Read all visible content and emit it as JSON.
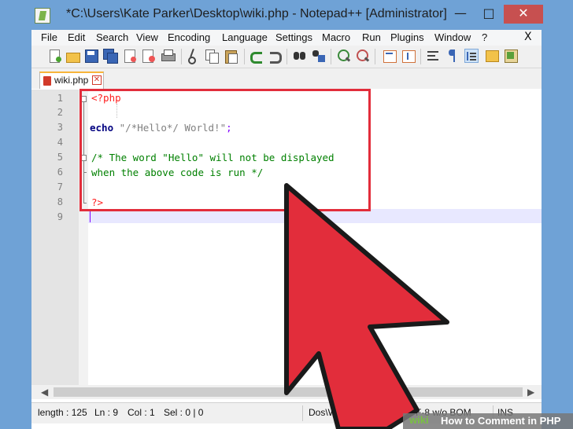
{
  "window": {
    "title": "*C:\\Users\\Kate Parker\\Desktop\\wiki.php - Notepad++ [Administrator]",
    "minimize_glyph": "—",
    "maximize_glyph": "□",
    "close_glyph": "✕"
  },
  "menu": {
    "items": [
      "File",
      "Edit",
      "Search",
      "View",
      "Encoding",
      "Language",
      "Settings",
      "Macro",
      "Run",
      "Plugins",
      "Window",
      "?"
    ],
    "close_glyph": "X"
  },
  "toolbar": {
    "icons": [
      "new-file-icon",
      "open-file-icon",
      "save-icon",
      "save-all-icon",
      "close-icon",
      "close-all-icon",
      "print-icon",
      "cut-icon",
      "copy-icon",
      "paste-icon",
      "undo-icon",
      "redo-icon",
      "find-icon",
      "replace-icon",
      "zoom-in-icon",
      "zoom-out-icon",
      "sync-vertical-icon",
      "sync-horizontal-icon",
      "word-wrap-icon",
      "show-all-chars-icon",
      "indent-guide-icon",
      "document-map-icon",
      "function-list-icon"
    ]
  },
  "tab": {
    "label": "wiki.php",
    "close_glyph": "✕"
  },
  "editor": {
    "line_numbers": [
      "1",
      "2",
      "3",
      "4",
      "5",
      "6",
      "7",
      "8",
      "9"
    ],
    "lines": {
      "l1": "<?php",
      "l3_kw": "echo",
      "l3_str": "\"/*Hello*/ World!\"",
      "l3_semicolon": ";",
      "l5": "/* The word \"Hello\" will not be displayed",
      "l6": "when the above code is run */",
      "l8": "?>"
    }
  },
  "status": {
    "length": "length : 125",
    "ln": "Ln : 9",
    "col": "Col : 1",
    "sel": "Sel : 0 | 0",
    "eol": "Dos\\Windows",
    "encoding": "UTF-8 w/o BOM",
    "mode": "INS"
  },
  "watermark": {
    "logo": "wiki",
    "text": "How to Comment in PHP"
  },
  "colors": {
    "accent_red": "#e22d3b",
    "title_bar": "#6fa2d6",
    "php_tag": "#ff2020",
    "keyword": "#000080",
    "comment": "#008000",
    "string": "#808080"
  }
}
